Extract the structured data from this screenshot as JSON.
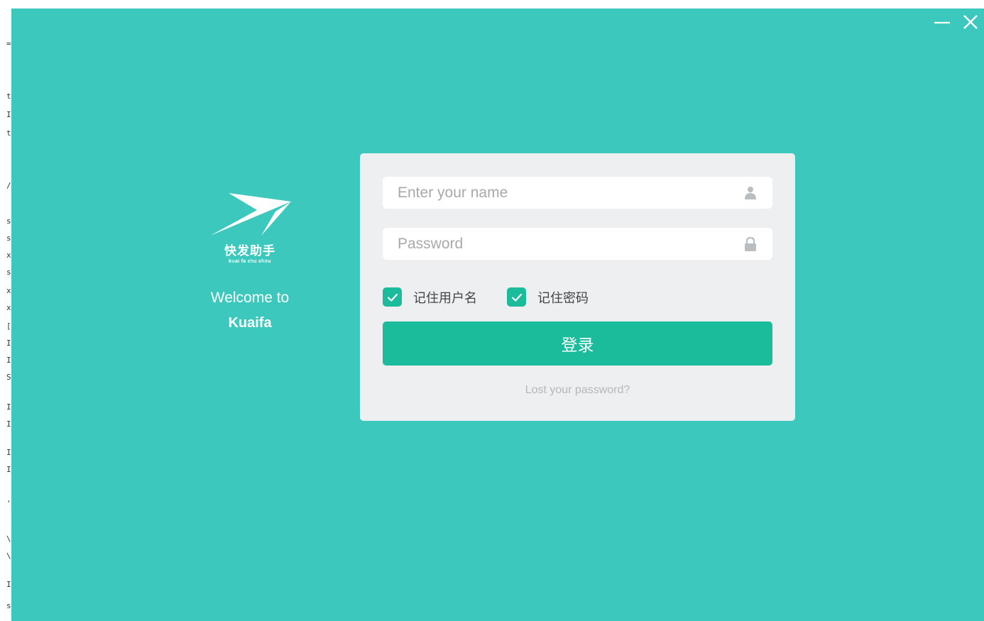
{
  "window_controls": {
    "minimize_icon": "minimize-icon",
    "close_icon": "close-icon"
  },
  "brand": {
    "logo_icon": "arrow-logo-icon",
    "chinese_name": "快发助手",
    "pinyin": "kuai fa zhu shou",
    "welcome_text": "Welcome to",
    "app_name": "Kuaifa"
  },
  "login_form": {
    "username": {
      "placeholder": "Enter your name",
      "value": "",
      "icon": "user-icon"
    },
    "password": {
      "placeholder": "Password",
      "value": "",
      "icon": "lock-icon"
    },
    "remember_username": {
      "label": "记住用户名",
      "checked": true
    },
    "remember_password": {
      "label": "记住密码",
      "checked": true
    },
    "login_button_label": "登录",
    "lost_password_link": "Lost your password?"
  },
  "colors": {
    "window_background": "#3cc8bc",
    "card_background": "#eeeff1",
    "accent": "#1abc9c"
  }
}
